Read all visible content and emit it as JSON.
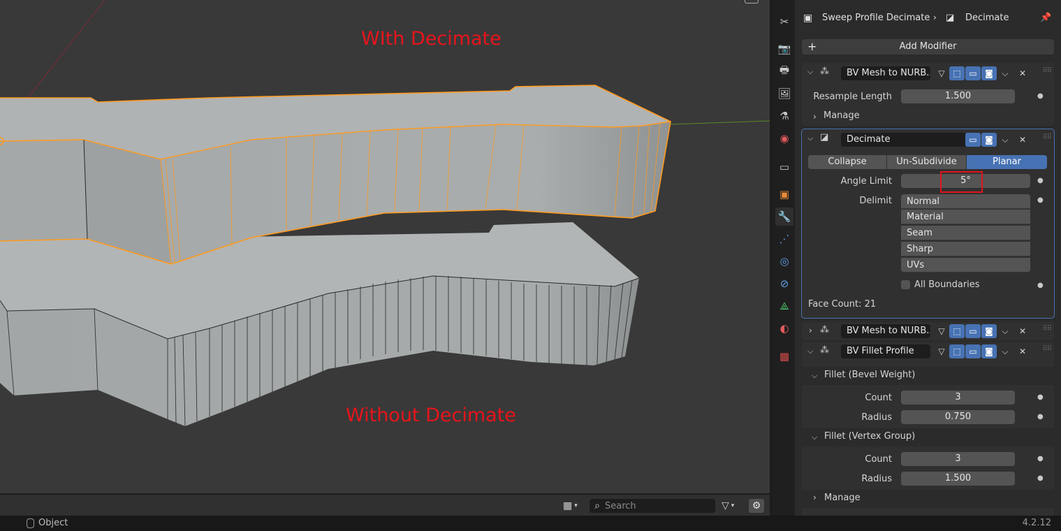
{
  "viewport": {
    "label_top": "WIth Decimate",
    "label_bottom": "Without Decimate",
    "colors": {
      "background": "#393939",
      "selection": "#ff9a1f",
      "mesh": "#b0b3b3",
      "xaxis": "#8a2a33",
      "yaxis": "#5a8a2a"
    }
  },
  "viewport_footer": {
    "search_placeholder": "Search",
    "icons": [
      "view-mode-icon",
      "search-icon",
      "filter-icon",
      "gear-icon"
    ]
  },
  "statusbar": {
    "mode": "Object",
    "version": "4.2.12"
  },
  "tabs": [
    "tool-icon",
    "render-icon",
    "output-icon",
    "view-layer-icon",
    "scene-icon",
    "world-icon",
    "collection-icon",
    "object-icon",
    "modifier-icon",
    "particles-icon",
    "physics-icon",
    "constraints-icon",
    "data-icon",
    "material-icon",
    "texture-icon"
  ],
  "properties": {
    "breadcrumb": {
      "object": "Sweep Profile Decimate",
      "modifier": "Decimate"
    },
    "add_modifier": "Add Modifier",
    "mod1": {
      "name": "BV Mesh to NURB...",
      "resample_label": "Resample Length",
      "resample_value": "1.500",
      "manage": "Manage"
    },
    "decimate": {
      "name": "Decimate",
      "modes": [
        "Collapse",
        "Un-Subdivide",
        "Planar"
      ],
      "selected_mode": "Planar",
      "angle_label": "Angle Limit",
      "angle_value": "5°",
      "delimit_label": "Delimit",
      "delimit": [
        "Normal",
        "Material",
        "Seam",
        "Sharp",
        "UVs"
      ],
      "all_boundaries": "All Boundaries",
      "face_count": "Face Count: 21"
    },
    "mod3": {
      "name": "BV Mesh to NURB..."
    },
    "mod4": {
      "name": "BV Fillet Profile",
      "panel1": "Fillet (Bevel Weight)",
      "panel1_count_label": "Count",
      "panel1_count": "3",
      "panel1_radius_label": "Radius",
      "panel1_radius": "0.750",
      "panel2": "Fillet (Vertex Group)",
      "panel2_count_label": "Count",
      "panel2_count": "3",
      "panel2_radius_label": "Radius",
      "panel2_radius": "1.500",
      "manage": "Manage"
    }
  }
}
